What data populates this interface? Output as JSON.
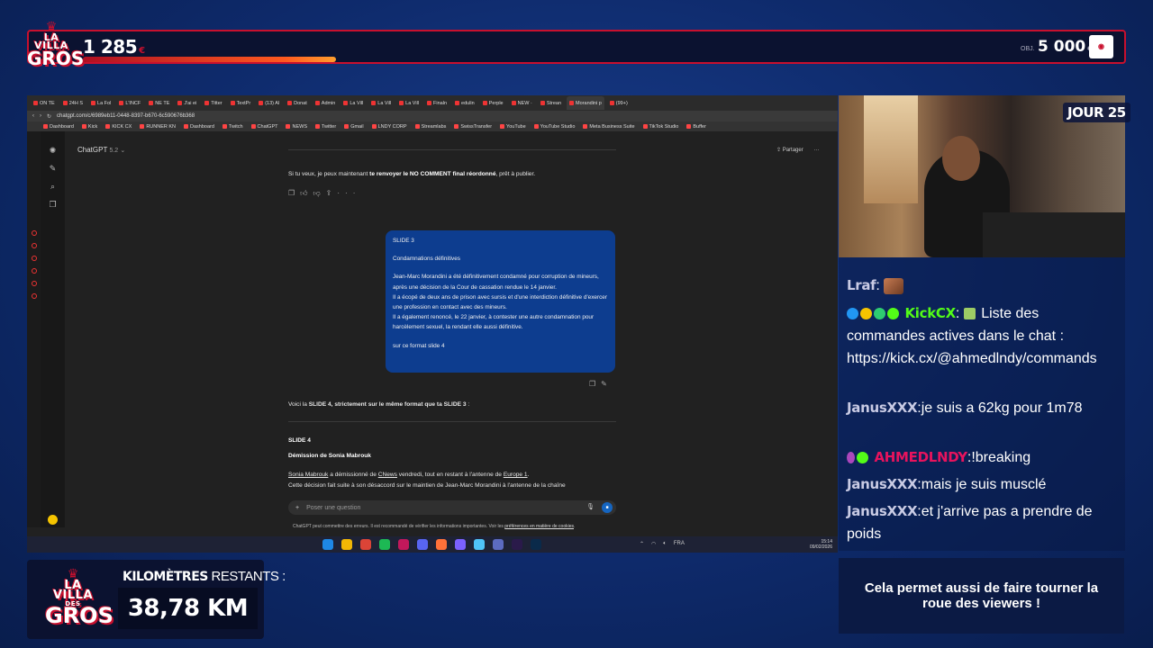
{
  "brand": {
    "line1": "LA VILLA",
    "line2": "DES",
    "line3": "GROS"
  },
  "topbar": {
    "score": "1 285",
    "score_unit": "€",
    "goal_label": "OBJ.",
    "goal": "5 000",
    "goal_unit": "€",
    "progress": 0.255
  },
  "browser": {
    "tabs": [
      "ON TE",
      "24H S",
      "La Fol",
      "L'INCF",
      "NE TE",
      "J'ai ei",
      "Titter",
      "TextPr",
      "(13) Al",
      "Donat",
      "Admin",
      "La Vill",
      "La Vill",
      "La Vill",
      "Finaln",
      "edulin",
      "Perple",
      "NEW ·",
      "Strean",
      "Morandini p",
      "(99+)"
    ],
    "url": "chatgpt.com/c/6989eb11-0448-8397-b670-6c590676b368",
    "bookmarks": [
      "Dashboard",
      "Kick",
      "KICK CX",
      "RUNNER KN",
      "Dashboard",
      "Twitch",
      "ChatGPT",
      "NEWS",
      "Twitter",
      "Gmail",
      "LNDY CORP",
      "Streamlabs",
      "SwissTransfer",
      "YouTube",
      "YouTube Studio",
      "Meta Business Suite",
      "TikTok Studio",
      "Buffer"
    ]
  },
  "gpt": {
    "model": "ChatGPT",
    "version": "5.2",
    "share": "Partager",
    "ai_line_pre": "Si tu veux, je peux maintenant ",
    "ai_line_bold": "te renvoyer le NO COMMENT final réordonné",
    "ai_line_post": ", prêt à publier.",
    "bubble": {
      "title": "SLIDE 3",
      "subtitle": "Condamnations définitives",
      "p1": "Jean-Marc Morandini a été définitivement condamné pour corruption de mineurs, après une décision de la Cour de cassation rendue le 14 janvier.",
      "p2": "Il a écopé de deux ans de prison avec sursis et d'une interdiction définitive d'exercer une profession en contact avec des mineurs.",
      "p3": "Il a également renoncé, le 22 janvier, à contester une autre condamnation pour harcèlement sexuel, la rendant elle aussi définitive.",
      "p4": "sur ce format slide 4"
    },
    "reply_pre": "Voici la ",
    "reply_bold": "SLIDE 4, strictement sur le même format que ta SLIDE 3",
    "reply_post": " :",
    "slide_title": "SLIDE 4",
    "slide_sub": "Démission de Sonia Mabrouk",
    "slide_line1_a": "Sonia Mabrouk",
    "slide_line1_b": " a démissionné de ",
    "slide_line1_c": "CNews",
    "slide_line1_d": " vendredi, tout en restant à l'antenne de ",
    "slide_line1_e": "Europe 1",
    "slide_line1_f": ".",
    "slide_line2": "Cette décision fait suite à son désaccord sur le maintien de Jean-Marc Morandini à l'antenne de la chaîne",
    "composer_placeholder": "Poser une question",
    "disclaimer_pre": "ChatGPT peut commettre des erreurs. Il est recommandé de vérifier les informations importantes. Voir les ",
    "disclaimer_link": "préférences en matière de cookies",
    "disclaimer_post": "."
  },
  "taskbar": {
    "lang": "FRA",
    "time": "15:14",
    "date": "09/02/2026"
  },
  "stream": {
    "day_badge": "JOUR 25",
    "chat": [
      {
        "user": "Lraf",
        "sep": ":",
        "text": ""
      },
      {
        "user": "KickCX",
        "sep": ":",
        "text": " Liste des commandes actives dans le chat : https://kick.cx/@ahmedlndy/commands"
      },
      {
        "user": "JanusXXX",
        "sep": ":",
        "text": "je suis a 62kg pour 1m78"
      },
      {
        "user": "AHMEDLNDY",
        "sep": ":",
        "text": "!breaking"
      },
      {
        "user": "JanusXXX",
        "sep": ":",
        "text": "mais je suis musclé"
      },
      {
        "user": "JanusXXX",
        "sep": ":",
        "text": "et j'arrive pas a prendre de poids"
      }
    ],
    "km_label_bold": "KILOMÈTRES",
    "km_label_light": " RESTANTS :",
    "km_value": "38,78 KM",
    "info": "Cela permet aussi de faire tourner la roue des viewers !"
  },
  "colors": {
    "accent_red": "#c8102e",
    "bubble_blue": "#0d3d8f",
    "kick_green": "#53fc18",
    "dark_panel": "#0b1230"
  }
}
